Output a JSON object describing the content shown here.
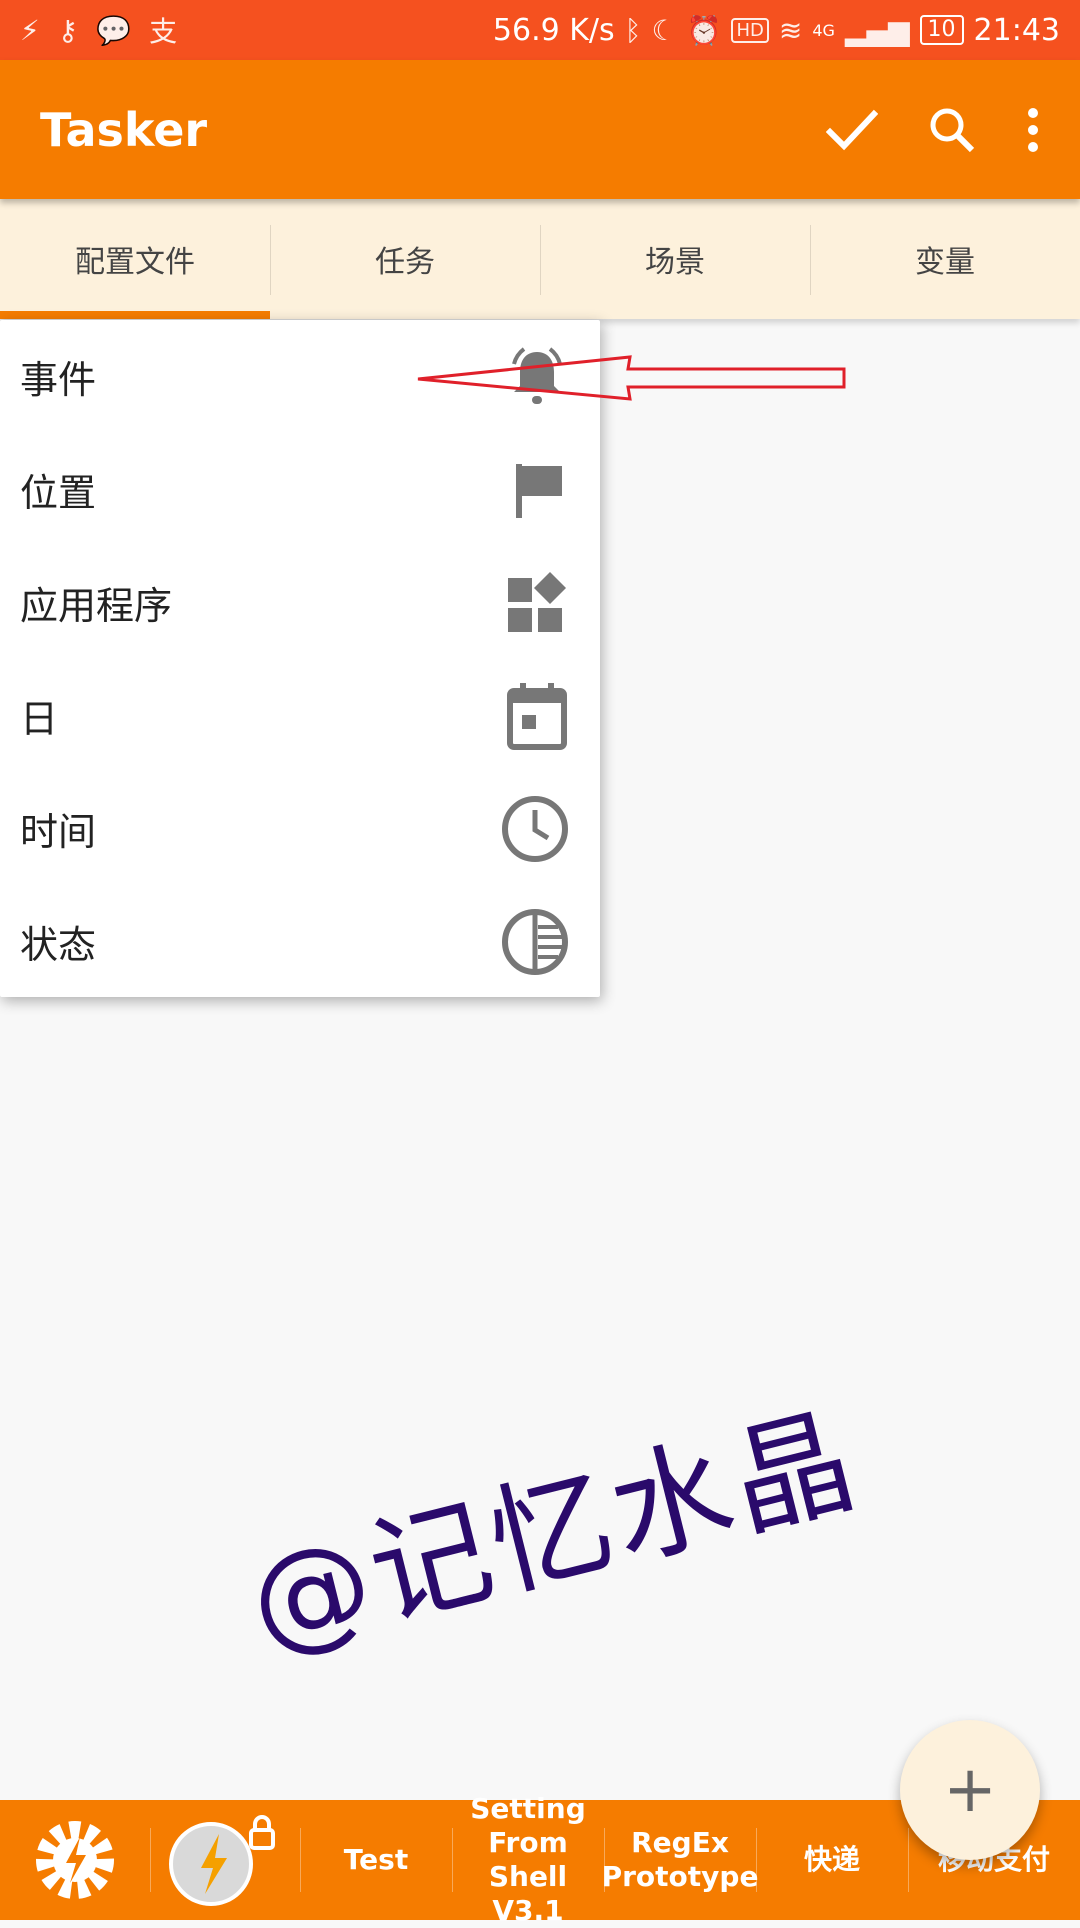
{
  "status_bar": {
    "network_speed": "56.9 K/s",
    "signal_label": "4G",
    "battery": "10",
    "time": "21:43"
  },
  "app_bar": {
    "title": "Tasker",
    "icons": [
      "check-icon",
      "search-icon",
      "more-vert-icon"
    ]
  },
  "tabs": [
    {
      "label": "配置文件",
      "active": true
    },
    {
      "label": "任务",
      "active": false
    },
    {
      "label": "场景",
      "active": false
    },
    {
      "label": "变量",
      "active": false
    }
  ],
  "menu": {
    "items": [
      {
        "label": "事件",
        "icon": "bell-icon"
      },
      {
        "label": "位置",
        "icon": "flag-icon"
      },
      {
        "label": "应用程序",
        "icon": "apps-icon"
      },
      {
        "label": "日",
        "icon": "calendar-icon"
      },
      {
        "label": "时间",
        "icon": "clock-icon"
      },
      {
        "label": "状态",
        "icon": "state-icon"
      }
    ]
  },
  "watermark": "@记忆水晶",
  "bottom_bar": {
    "items": [
      "Test",
      "Setting From Shell V3.1",
      "RegEx Prototype",
      "快递",
      "移动支付"
    ]
  },
  "fab": {
    "label": "+"
  },
  "colors": {
    "status_bar": "#f5511f",
    "app_bar": "#f57c00",
    "tab_bg": "#fdf1dc",
    "annotation_arrow": "#e0202a"
  }
}
